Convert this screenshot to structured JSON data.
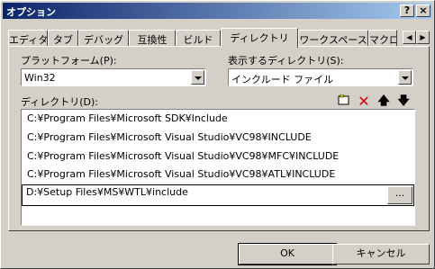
{
  "window": {
    "title": "オプション",
    "help_glyph": "?",
    "close_glyph": "×"
  },
  "tabs": [
    {
      "label": "エディタ"
    },
    {
      "label": "タブ"
    },
    {
      "label": "デバッグ"
    },
    {
      "label": "互換性"
    },
    {
      "label": "ビルド"
    },
    {
      "label": "ディレクトリ",
      "active": true
    },
    {
      "label": "ワークスペース"
    },
    {
      "label": "マクロ"
    }
  ],
  "tab_scroll": {
    "left": "◀",
    "right": "▶"
  },
  "platform": {
    "label": "プラットフォーム(P):",
    "value": "Win32"
  },
  "show_dirs": {
    "label": "表示するディレクトリ(S):",
    "value": "インクルード ファイル"
  },
  "directories": {
    "label": "ディレクトリ(D):",
    "items": [
      "C:¥Program Files¥Microsoft SDK¥Include",
      "C:¥Program Files¥Microsoft Visual Studio¥VC98¥INCLUDE",
      "C:¥Program Files¥Microsoft Visual Studio¥VC98¥MFC¥INCLUDE",
      "C:¥Program Files¥Microsoft Visual Studio¥VC98¥ATL¥INCLUDE"
    ],
    "editing_value": "D:¥Setup Files¥MS¥WTL¥include",
    "browse_label": "..."
  },
  "toolbar_icons": [
    "new-folder-icon",
    "delete-icon",
    "move-up-icon",
    "move-down-icon"
  ],
  "buttons": {
    "ok": "OK",
    "cancel": "キャンセル"
  },
  "colors": {
    "title_start": "#0a246a",
    "title_end": "#a6caf0",
    "delete_red": "#cc0000"
  }
}
